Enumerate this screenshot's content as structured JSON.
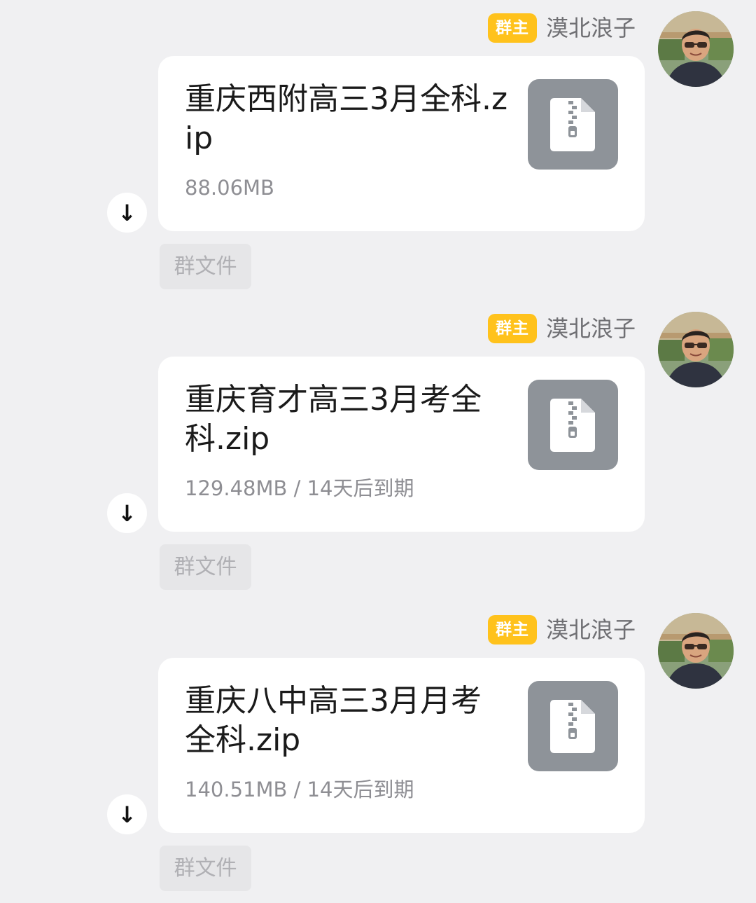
{
  "messages": [
    {
      "sender": {
        "role_badge": "群主",
        "name": "漠北浪子"
      },
      "file": {
        "name": "重庆西附高三3月全科.zip",
        "meta": "88.06MB",
        "icon": "zip-file-icon"
      },
      "download_icon": "↓",
      "source_tag": "群文件"
    },
    {
      "sender": {
        "role_badge": "群主",
        "name": "漠北浪子"
      },
      "file": {
        "name": "重庆育才高三3月考全科.zip",
        "meta": "129.48MB / 14天后到期",
        "icon": "zip-file-icon"
      },
      "download_icon": "↓",
      "source_tag": "群文件"
    },
    {
      "sender": {
        "role_badge": "群主",
        "name": "漠北浪子"
      },
      "file": {
        "name": "重庆八中高三3月月考全科.zip",
        "meta": "140.51MB / 14天后到期",
        "icon": "zip-file-icon"
      },
      "download_icon": "↓",
      "source_tag": "群文件"
    }
  ],
  "colors": {
    "background": "#f0f0f2",
    "bubble": "#ffffff",
    "role_badge": "#ffc21c",
    "file_thumb": "#8e9399",
    "source_tag_bg": "#e6e6e8"
  }
}
